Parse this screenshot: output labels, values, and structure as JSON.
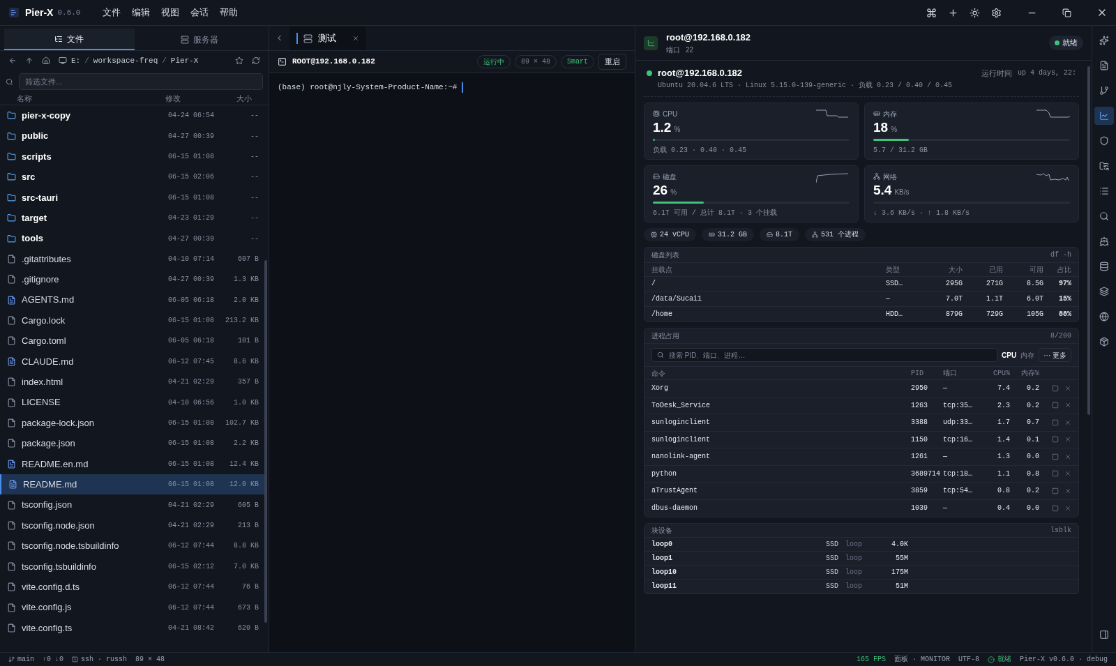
{
  "titlebar": {
    "app_name": "Pier-X",
    "version": "0.6.0",
    "menu": [
      "文件",
      "编辑",
      "视图",
      "会话",
      "帮助"
    ]
  },
  "left_panel": {
    "tabs": [
      {
        "label": "文件",
        "selected": true
      },
      {
        "label": "服务器",
        "selected": false
      }
    ],
    "path": [
      "E:",
      "workspace-freq",
      "Pier-X"
    ],
    "path_separator": "/",
    "filter": {
      "placeholder": "筛选文件..."
    },
    "columns": [
      "名称",
      "修改",
      "大小"
    ],
    "files": [
      {
        "name": "pier-x-copy",
        "modified": "04-24 06:54",
        "size": "--",
        "kind": "folder",
        "selected": false
      },
      {
        "name": "public",
        "modified": "04-27 00:39",
        "size": "--",
        "kind": "folder",
        "selected": false
      },
      {
        "name": "scripts",
        "modified": "06-15 01:08",
        "size": "--",
        "kind": "folder",
        "selected": false
      },
      {
        "name": "src",
        "modified": "06-15 02:06",
        "size": "--",
        "kind": "folder",
        "selected": false
      },
      {
        "name": "src-tauri",
        "modified": "06-15 01:08",
        "size": "--",
        "kind": "folder",
        "selected": false
      },
      {
        "name": "target",
        "modified": "04-23 01:29",
        "size": "--",
        "kind": "folder",
        "selected": false
      },
      {
        "name": "tools",
        "modified": "04-27 00:39",
        "size": "--",
        "kind": "folder",
        "selected": false
      },
      {
        "name": ".gitattributes",
        "modified": "04-10 07:14",
        "size": "607 B",
        "kind": "file",
        "selected": false
      },
      {
        "name": ".gitignore",
        "modified": "04-27 00:39",
        "size": "1.3 KB",
        "kind": "file",
        "selected": false
      },
      {
        "name": "AGENTS.md",
        "modified": "06-05 06:18",
        "size": "2.0 KB",
        "kind": "doc",
        "selected": false
      },
      {
        "name": "Cargo.lock",
        "modified": "06-15 01:08",
        "size": "213.2 KB",
        "kind": "file",
        "selected": false
      },
      {
        "name": "Cargo.toml",
        "modified": "06-05 06:18",
        "size": "101 B",
        "kind": "file",
        "selected": false
      },
      {
        "name": "CLAUDE.md",
        "modified": "06-12 07:45",
        "size": "8.6 KB",
        "kind": "doc",
        "selected": false
      },
      {
        "name": "index.html",
        "modified": "04-21 02:29",
        "size": "357 B",
        "kind": "file",
        "selected": false
      },
      {
        "name": "LICENSE",
        "modified": "04-10 06:56",
        "size": "1.0 KB",
        "kind": "file",
        "selected": false
      },
      {
        "name": "package-lock.json",
        "modified": "06-15 01:08",
        "size": "102.7 KB",
        "kind": "file",
        "selected": false
      },
      {
        "name": "package.json",
        "modified": "06-15 01:08",
        "size": "2.2 KB",
        "kind": "file",
        "selected": false
      },
      {
        "name": "README.en.md",
        "modified": "06-15 01:08",
        "size": "12.4 KB",
        "kind": "doc",
        "selected": false
      },
      {
        "name": "README.md",
        "modified": "06-15 01:08",
        "size": "12.0 KB",
        "kind": "doc",
        "selected": true
      },
      {
        "name": "tsconfig.json",
        "modified": "04-21 02:29",
        "size": "605 B",
        "kind": "file",
        "selected": false
      },
      {
        "name": "tsconfig.node.json",
        "modified": "04-21 02:29",
        "size": "213 B",
        "kind": "file",
        "selected": false
      },
      {
        "name": "tsconfig.node.tsbuildinfo",
        "modified": "06-12 07:44",
        "size": "8.8 KB",
        "kind": "file",
        "selected": false
      },
      {
        "name": "tsconfig.tsbuildinfo",
        "modified": "06-15 02:12",
        "size": "7.0 KB",
        "kind": "file",
        "selected": false
      },
      {
        "name": "vite.config.d.ts",
        "modified": "06-12 07:44",
        "size": "76 B",
        "kind": "file",
        "selected": false
      },
      {
        "name": "vite.config.js",
        "modified": "06-12 07:44",
        "size": "673 B",
        "kind": "file",
        "selected": false
      },
      {
        "name": "vite.config.ts",
        "modified": "04-21 08:42",
        "size": "620 B",
        "kind": "file",
        "selected": false
      }
    ]
  },
  "terminal": {
    "tabs": [
      {
        "label": "测试",
        "selected": true
      }
    ],
    "title": "ROOT@192.168.0.182",
    "badges": [
      {
        "text": "运行中",
        "kind": "status"
      },
      {
        "text": "89 × 48",
        "kind": "plain"
      },
      {
        "text": "Smart",
        "kind": "status"
      }
    ],
    "restart": "重启",
    "prompt": "(base) root@njly-System-Product-Name:~# "
  },
  "monitor": {
    "header": {
      "host": "root@192.168.0.182",
      "port_label": "端口",
      "port": "22",
      "status": "就绪"
    },
    "host_line": {
      "host": "root@192.168.0.182",
      "info": "Ubuntu 20.04.6 LTS · Linux 5.15.0-139-generic · 负载 0.23 / 0.40 / 0.45",
      "uptime_label": "运行时间",
      "uptime": "up 4 days, 22:"
    },
    "cards": [
      {
        "kind": "cpu",
        "label": "CPU",
        "value": "1.2",
        "unit": "%",
        "level": 0.012,
        "detail": "负载 0.23 · 0.40 · 0.45"
      },
      {
        "kind": "memory",
        "label": "内存",
        "value": "18",
        "unit": "%",
        "level": 0.18,
        "detail": "5.7 / 31.2 GB"
      },
      {
        "kind": "disk",
        "label": "磁盘",
        "value": "26",
        "unit": "%",
        "level": 0.26,
        "detail": "6.1T 可用 / 总计 8.1T · 3 个挂载"
      },
      {
        "kind": "network",
        "label": "网络",
        "value": "5.4",
        "unit": "KB/s",
        "detail": "↓ 3.6 KB/s · ↑ 1.8 KB/s"
      }
    ],
    "chips": [
      {
        "kind": "cpu",
        "text": "24 vCPU"
      },
      {
        "kind": "memory",
        "text": "31.2 GB"
      },
      {
        "kind": "disk",
        "text": "8.1T"
      },
      {
        "kind": "network",
        "text": "531 个进程"
      }
    ],
    "disks": {
      "title": "磁盘列表",
      "command": "df -h",
      "columns": [
        "挂载点",
        "类型",
        "大小",
        "已用",
        "可用",
        "占比"
      ],
      "rows": [
        [
          "/",
          "SSD…",
          "295G",
          "271G",
          "8.5G",
          "97%"
        ],
        [
          "/data/Sucai1",
          "—",
          "7.0T",
          "1.1T",
          "6.0T",
          "15%"
        ],
        [
          "/home",
          "HDD…",
          "879G",
          "729G",
          "105G",
          "88%"
        ]
      ]
    },
    "processes": {
      "title": "进程占用",
      "count": "8/200",
      "search_placeholder": "搜索 PID、端口、进程…",
      "sort_options": [
        {
          "label": "CPU",
          "selected": true
        },
        {
          "label": "内存",
          "selected": false
        }
      ],
      "more": "··· 更多",
      "columns": [
        "命令",
        "PID",
        "端口",
        "CPU%",
        "内存%"
      ],
      "rows": [
        [
          "Xorg",
          "2950",
          "—",
          "7.4",
          "0.2"
        ],
        [
          "ToDesk_Service",
          "1263",
          "tcp:35…",
          "2.3",
          "0.2"
        ],
        [
          "sunloginclient",
          "3388",
          "udp:33…",
          "1.7",
          "0.7"
        ],
        [
          "sunloginclient",
          "1150",
          "tcp:16…",
          "1.4",
          "0.1"
        ],
        [
          "nanolink-agent",
          "1261",
          "—",
          "1.3",
          "0.0"
        ],
        [
          "python",
          "3689714",
          "tcp:18…",
          "1.1",
          "0.8"
        ],
        [
          "aTrustAgent",
          "3859",
          "tcp:54…",
          "0.8",
          "0.2"
        ],
        [
          "dbus-daemon",
          "1039",
          "—",
          "0.4",
          "0.0"
        ]
      ]
    },
    "block_devices": {
      "title": "块设备",
      "command": "lsblk",
      "rows": [
        [
          "loop0",
          "SSD",
          "loop",
          "4.0K"
        ],
        [
          "loop1",
          "SSD",
          "loop",
          "55M"
        ],
        [
          "loop10",
          "SSD",
          "loop",
          "175M"
        ],
        [
          "loop11",
          "SSD",
          "loop",
          "51M"
        ]
      ]
    }
  },
  "activity_bar": [
    {
      "selected": false
    },
    {
      "selected": false
    },
    {
      "selected": false
    },
    {
      "selected": true
    },
    {
      "selected": false
    },
    {
      "selected": false
    },
    {
      "selected": false
    },
    {
      "selected": false
    },
    {
      "selected": false
    },
    {
      "selected": false
    },
    {
      "selected": false
    },
    {
      "selected": false
    },
    {
      "selected": false
    },
    {
      "selected": false
    }
  ],
  "status_bar": {
    "branch": "main",
    "sync": "↑0 ↓0",
    "shell": "ssh · russh",
    "size": "89 × 48",
    "fps": "165 FPS",
    "panel": "面板 · MONITOR",
    "encoding": "UTF-8",
    "state": "就绪",
    "version": "Pier-X v0.6.0 · debug"
  }
}
